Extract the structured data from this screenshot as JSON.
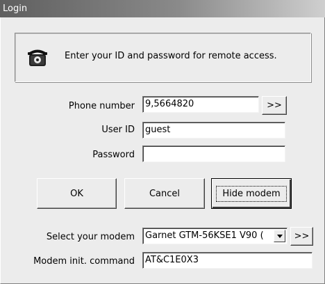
{
  "window": {
    "title": "Login"
  },
  "banner": {
    "icon": "telephone-icon",
    "message": "Enter your ID and password for remote access."
  },
  "form": {
    "phone_label": "Phone number",
    "phone_value": "9,5664820",
    "phone_more": ">>",
    "userid_label": "User ID",
    "userid_value": "guest",
    "password_label": "Password",
    "password_value": ""
  },
  "buttons": {
    "ok": "OK",
    "cancel": "Cancel",
    "hide_modem": "Hide modem"
  },
  "modem": {
    "select_label": "Select your modem",
    "selected": "Garnet GTM-56KSE1 V90 (",
    "more": ">>",
    "init_label": "Modem init. command",
    "init_value": "AT&C1E0X3"
  }
}
